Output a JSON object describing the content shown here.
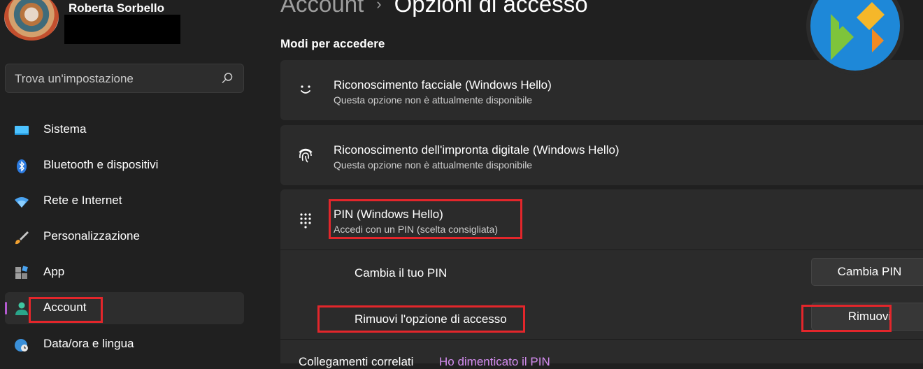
{
  "user": {
    "name": "Roberta Sorbello"
  },
  "search": {
    "placeholder": "Trova un'impostazione"
  },
  "sidebar": {
    "items": [
      {
        "label": "Sistema",
        "icon": "monitor-icon"
      },
      {
        "label": "Bluetooth e dispositivi",
        "icon": "bluetooth-icon"
      },
      {
        "label": "Rete e Internet",
        "icon": "wifi-icon"
      },
      {
        "label": "Personalizzazione",
        "icon": "brush-icon"
      },
      {
        "label": "App",
        "icon": "apps-icon"
      },
      {
        "label": "Account",
        "icon": "person-icon",
        "selected": true
      },
      {
        "label": "Data/ora e lingua",
        "icon": "globe-clock-icon"
      }
    ]
  },
  "breadcrumb": {
    "parent": "Account",
    "separator": "›",
    "current": "Opzioni di accesso"
  },
  "section": {
    "title": "Modi per accedere"
  },
  "options": [
    {
      "title": "Riconoscimento facciale (Windows Hello)",
      "subtitle": "Questa opzione non è attualmente disponibile",
      "icon": "face-icon"
    },
    {
      "title": "Riconoscimento dell'impronta digitale (Windows Hello)",
      "subtitle": "Questa opzione non è attualmente disponibile",
      "icon": "fingerprint-icon"
    },
    {
      "title": "PIN (Windows Hello)",
      "subtitle": "Accedi con un PIN (scelta consigliata)",
      "icon": "keypad-icon",
      "expanded": true
    }
  ],
  "pin": {
    "change_label": "Cambia il tuo PIN",
    "change_button": "Cambia PIN",
    "remove_label": "Rimuovi l'opzione di accesso",
    "remove_button": "Rimuovi"
  },
  "related": {
    "label": "Collegamenti correlati",
    "link": "Ho dimenticato il PIN"
  },
  "colors": {
    "background": "#202020",
    "card": "#2b2b2b",
    "accent": "#b45ad0",
    "highlight": "#e3262b",
    "link": "#d48cf0"
  }
}
